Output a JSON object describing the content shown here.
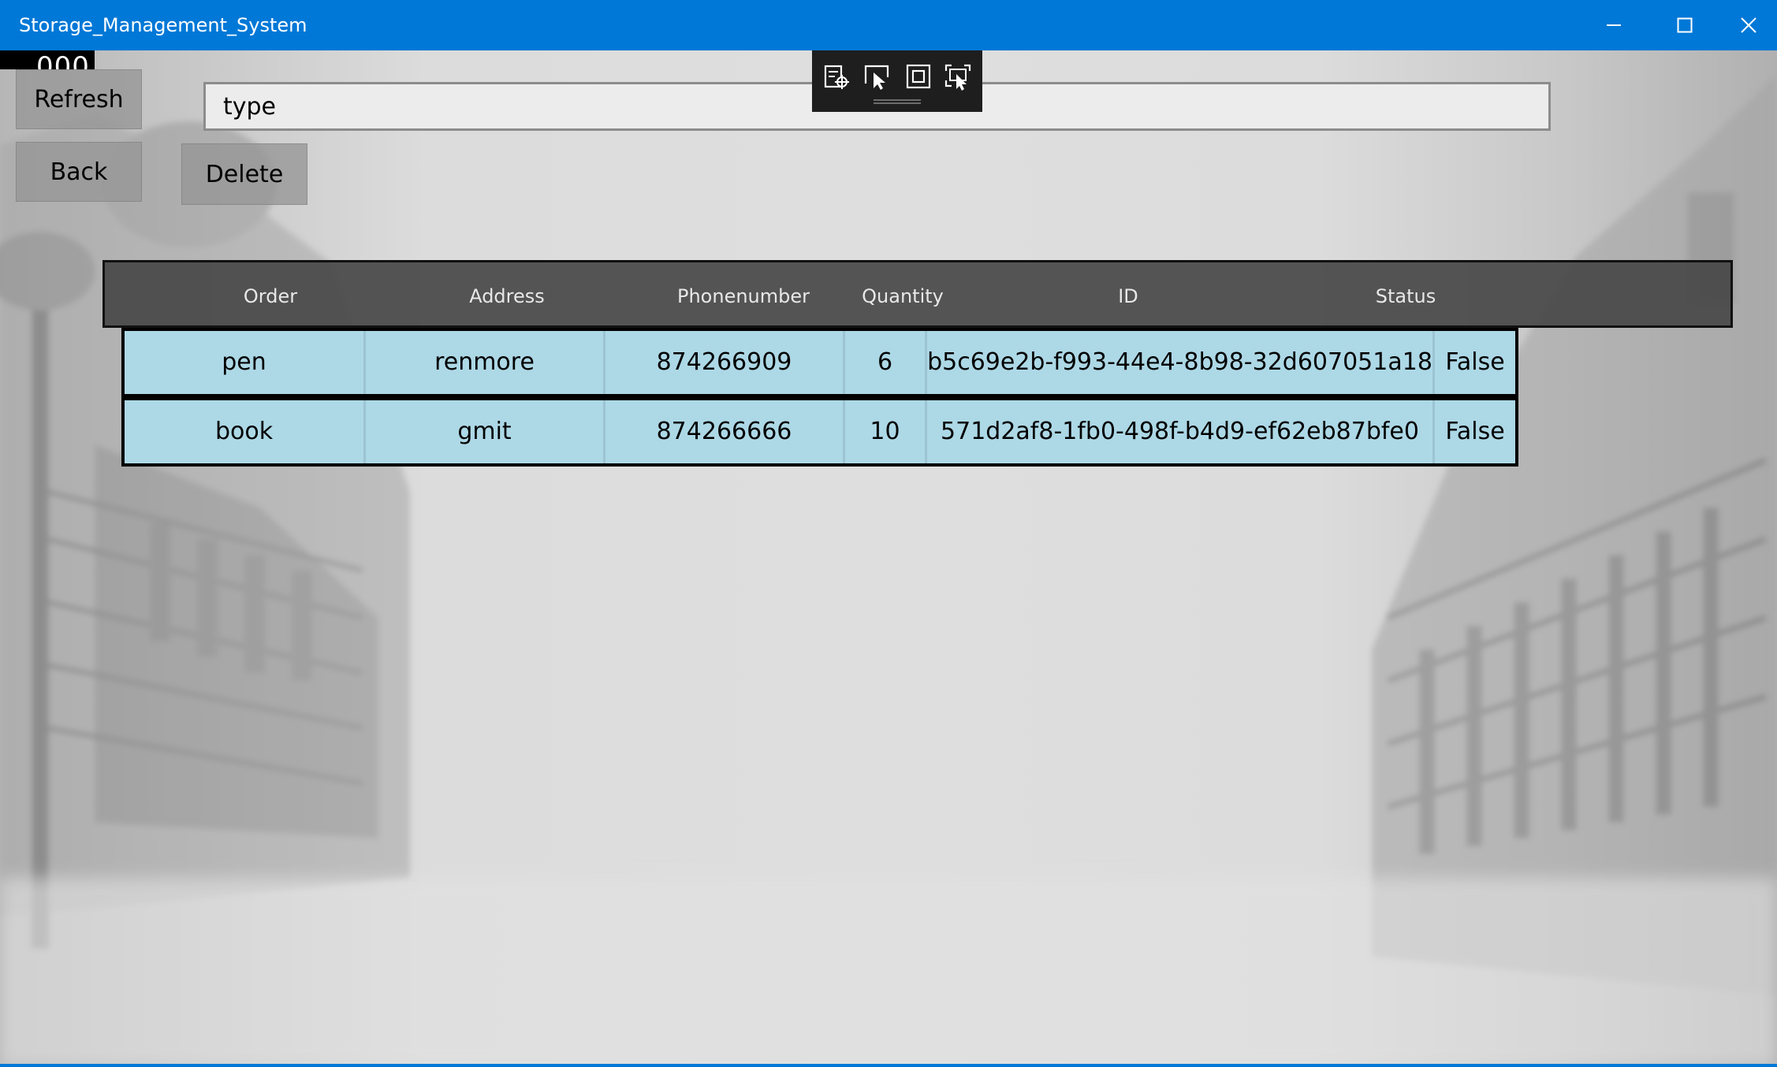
{
  "window": {
    "title": "Storage_Management_System",
    "minimize_icon": "minimize-icon",
    "maximize_icon": "maximize-icon",
    "close_icon": "close-icon",
    "accent_color": "#0078d7"
  },
  "frame_counter": {
    "value": "000"
  },
  "toolbar": {
    "refresh_label": "Refresh",
    "back_label": "Back",
    "delete_label": "Delete"
  },
  "search": {
    "value": "type"
  },
  "debug_toolbar": {
    "icons": [
      "live-visual-tree-icon",
      "select-element-icon",
      "display-layout-adorners-icon",
      "track-focus-icon"
    ]
  },
  "grid": {
    "headers": [
      "Order",
      "Address",
      "Phonenumber",
      "Quantity",
      "ID",
      "Status"
    ],
    "row_color": "#add8e6",
    "header_color": "#484848",
    "rows": [
      {
        "order": "pen",
        "address": "renmore",
        "phone": "874266909",
        "quantity": "6",
        "id": "b5c69e2b-f993-44e4-8b98-32d607051a18",
        "status": "False"
      },
      {
        "order": "book",
        "address": "gmit",
        "phone": "874266666",
        "quantity": "10",
        "id": "571d2af8-1fb0-498f-b4d9-ef62eb87bfe0",
        "status": "False"
      }
    ]
  }
}
